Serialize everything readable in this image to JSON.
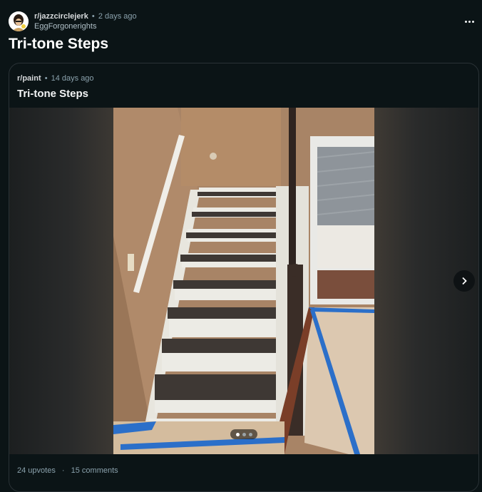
{
  "post": {
    "subreddit": "r/jazzcirclejerk",
    "age": "2 days ago",
    "username": "EggForgonerights",
    "title": "Tri-tone Steps",
    "separator": "•"
  },
  "crosspost": {
    "subreddit": "r/paint",
    "age": "14 days ago",
    "title": "Tri-tone Steps",
    "gallery": {
      "current": 1,
      "total": 3
    },
    "upvotes": "24 upvotes",
    "comments": "15 comments",
    "footer_sep": "·"
  },
  "icons": {
    "avatar": "avatar-icon",
    "more": "more-icon",
    "next": "chevron-right-icon"
  },
  "colors": {
    "background": "#0b1416",
    "border": "#2a3236",
    "meta_text": "#8ba2ad"
  }
}
